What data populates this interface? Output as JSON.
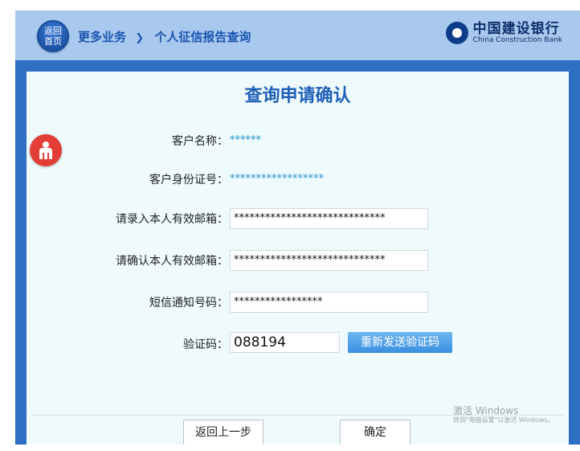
{
  "header": {
    "home_label": "返回首页",
    "breadcrumb_parent": "更多业务",
    "breadcrumb_sep": "❯",
    "breadcrumb_current": "个人征信报告查询",
    "bank_name_cn": "中国建设银行",
    "bank_name_en": "China Construction Bank"
  },
  "form": {
    "title": "查询申请确认",
    "customer_name_label": "客户名称：",
    "customer_name_value": "******",
    "id_number_label": "客户身份证号：",
    "id_number_value": "******************",
    "email_label": "请录入本人有效邮箱：",
    "email_value": "*****************************",
    "email_confirm_label": "请确认本人有效邮箱：",
    "email_confirm_value": "*****************************",
    "sms_label": "短信通知号码：",
    "sms_value": "*****************",
    "code_label": "验证码：",
    "code_value": "088194",
    "resend_label": "重新发送验证码"
  },
  "actions": {
    "back_label": "返回上一步",
    "confirm_label": "确定"
  },
  "watermark": {
    "line1": "激活 Windows",
    "line2": "转到\"电脑设置\"以激活 Windows。"
  },
  "colors": {
    "header_bg": "#a9c8ee",
    "frame_bg": "#2f6fc3",
    "panel_bg": "#eefafc",
    "title": "#1e5fb8",
    "value_text": "#1e8fd0",
    "resend_button": "#4a9ee6",
    "side_badge": "#e23d36"
  },
  "icons": {
    "home": "home-circle-icon",
    "bank_logo": "ccb-logo-icon",
    "side_badge": "service-figure-icon"
  }
}
